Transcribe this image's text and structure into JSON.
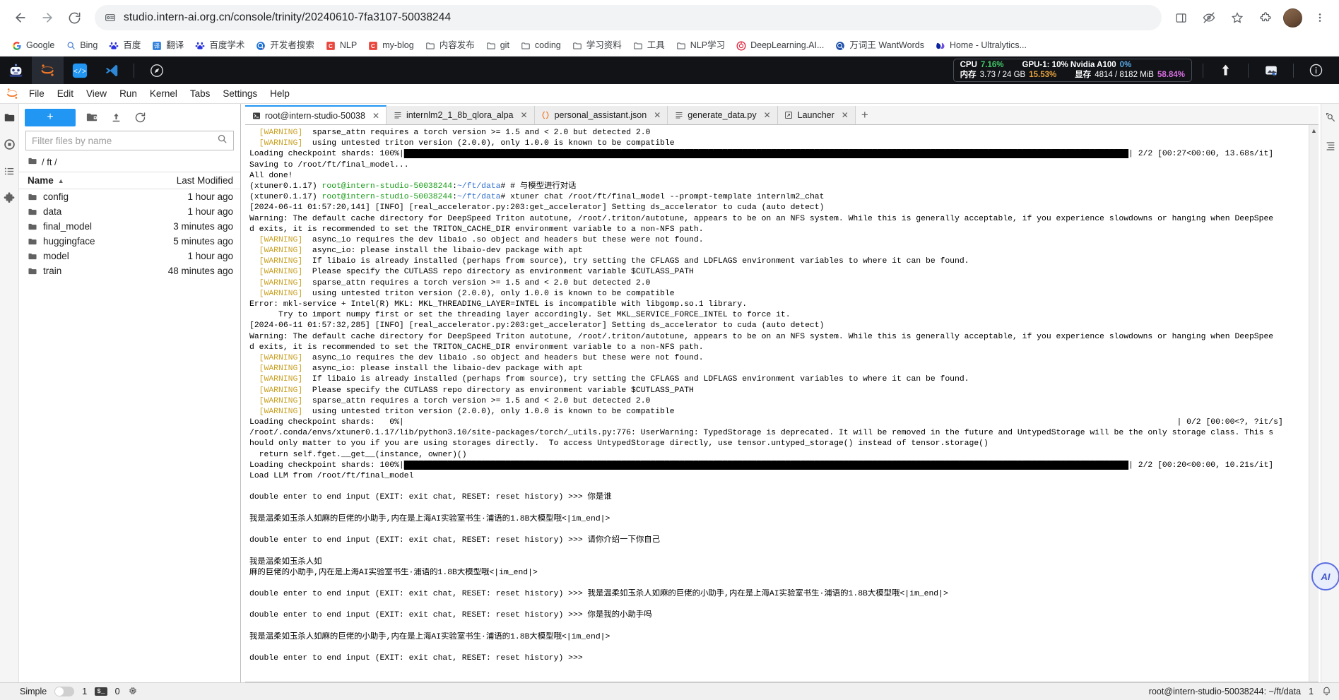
{
  "browser": {
    "url": "studio.intern-ai.org.cn/console/trinity/20240610-7fa3107-50038244",
    "nav": {
      "back": "back-arrow",
      "forward": "forward-arrow",
      "reload": "reload"
    },
    "bookmarks": [
      {
        "label": "Google",
        "icon": "G",
        "icon_kind": "google"
      },
      {
        "label": "Bing",
        "icon": "b",
        "icon_kind": "bing"
      },
      {
        "label": "百度",
        "icon": "B",
        "icon_kind": "baidu"
      },
      {
        "label": "翻译",
        "icon": "译",
        "icon_kind": "fanyi"
      },
      {
        "label": "百度学术",
        "icon": "B",
        "icon_kind": "baidu"
      },
      {
        "label": "开发者搜索",
        "icon": "Q",
        "icon_kind": "devsearch"
      },
      {
        "label": "NLP",
        "icon": "C",
        "icon_kind": "csdn"
      },
      {
        "label": "my-blog",
        "icon": "C",
        "icon_kind": "csdn"
      },
      {
        "label": "内容发布",
        "icon": "",
        "icon_kind": "folder"
      },
      {
        "label": "git",
        "icon": "",
        "icon_kind": "folder"
      },
      {
        "label": "coding",
        "icon": "",
        "icon_kind": "folder"
      },
      {
        "label": "学习资料",
        "icon": "",
        "icon_kind": "folder"
      },
      {
        "label": "工具",
        "icon": "",
        "icon_kind": "folder"
      },
      {
        "label": "NLP学习",
        "icon": "",
        "icon_kind": "folder"
      },
      {
        "label": "DeepLearning.AI...",
        "icon": "",
        "icon_kind": "dlai"
      },
      {
        "label": "万词王 WantWords",
        "icon": "",
        "icon_kind": "wantwords"
      },
      {
        "label": "Home - Ultralytics...",
        "icon": "",
        "icon_kind": "ultralytics"
      }
    ]
  },
  "topbar": {
    "icons": [
      "robot-logo-icon",
      "jupyter-logo-icon",
      "vscode-web-icon",
      "vscode-icon",
      "compass-icon"
    ],
    "right_icons": [
      "upload-icon",
      "image-toggle-icon",
      "info-icon"
    ],
    "sysmon": {
      "cpu_label": "CPU",
      "cpu_value": "7.16%",
      "cpu_color": "#45c96b",
      "mem_label": "内存",
      "mem_value": "3.73 / 24 GB",
      "mem_percent": "15.53%",
      "mem_color": "#e8a33d",
      "gpu_label": "GPU-1: 10% Nvidia A100",
      "gpu_value": "0%",
      "gpu_color": "#5aa9e6",
      "vram_label": "显存",
      "vram_value": "4814 / 8182 MiB",
      "vram_percent": "58.84%",
      "vram_color": "#d96fe0"
    }
  },
  "menubar": {
    "items": [
      "File",
      "Edit",
      "View",
      "Run",
      "Kernel",
      "Tabs",
      "Settings",
      "Help"
    ]
  },
  "rail": {
    "left_icons": [
      "folder-icon",
      "running-terminals-icon",
      "commands-icon",
      "extensions-icon"
    ],
    "right_icons": [
      "property-inspector-icon",
      "toc-icon"
    ]
  },
  "filebrowser": {
    "new_button": "+",
    "toolbar_icons": [
      "new-folder-icon",
      "upload-icon",
      "refresh-icon"
    ],
    "filter_placeholder": "Filter files by name",
    "filter_value": "",
    "breadcrumb": "/ ft /",
    "columns": {
      "name": "Name",
      "modified": "Last Modified"
    },
    "rows": [
      {
        "name": "config",
        "modified": "1 hour ago"
      },
      {
        "name": "data",
        "modified": "1 hour ago"
      },
      {
        "name": "final_model",
        "modified": "3 minutes ago"
      },
      {
        "name": "huggingface",
        "modified": "5 minutes ago"
      },
      {
        "name": "model",
        "modified": "1 hour ago"
      },
      {
        "name": "train",
        "modified": "48 minutes ago"
      }
    ]
  },
  "tabs": [
    {
      "label": "root@intern-studio-50038",
      "icon": "terminal-icon",
      "active": true
    },
    {
      "label": "internlm2_1_8b_qlora_alpa",
      "icon": "text-file-icon",
      "active": false
    },
    {
      "label": "personal_assistant.json",
      "icon": "json-file-icon",
      "active": false
    },
    {
      "label": "generate_data.py",
      "icon": "python-file-icon",
      "active": false
    },
    {
      "label": "Launcher",
      "icon": "launcher-icon",
      "active": false
    }
  ],
  "tab_add_label": "+",
  "terminal": {
    "lines": [
      [
        {
          "t": "  ",
          "c": ""
        },
        {
          "t": "[WARNING]",
          "c": "warn"
        },
        {
          "t": "  sparse_attn requires a torch version >= 1.5 and < 2.0 but detected 2.0",
          "c": ""
        }
      ],
      [
        {
          "t": "  ",
          "c": ""
        },
        {
          "t": "[WARNING]",
          "c": "warn"
        },
        {
          "t": "  using untested triton version (2.0.0), only 1.0.0 is known to be compatible",
          "c": ""
        }
      ],
      [
        {
          "t": "Loading checkpoint shards: 100%|",
          "c": ""
        },
        {
          "t": "██████████████████████████████████████████████████████████████████████████████████████████████████████████████████████████████████████████████████████",
          "c": "bar"
        },
        {
          "t": "| 2/2 [00:27<00:00, 13.68s/it]",
          "c": ""
        }
      ],
      [
        {
          "t": "Saving to /root/ft/final_model...",
          "c": ""
        }
      ],
      [
        {
          "t": "All done!",
          "c": ""
        }
      ],
      [
        {
          "t": "(xtuner0.1.17) ",
          "c": ""
        },
        {
          "t": "root@intern-studio-50038244",
          "c": "green"
        },
        {
          "t": ":",
          "c": ""
        },
        {
          "t": "~/ft/data",
          "c": "blue"
        },
        {
          "t": "# # 与模型进行对话",
          "c": ""
        }
      ],
      [
        {
          "t": "(xtuner0.1.17) ",
          "c": ""
        },
        {
          "t": "root@intern-studio-50038244",
          "c": "green"
        },
        {
          "t": ":",
          "c": ""
        },
        {
          "t": "~/ft/data",
          "c": "blue"
        },
        {
          "t": "# xtuner chat /root/ft/final_model --prompt-template internlm2_chat",
          "c": ""
        }
      ],
      [
        {
          "t": "[2024-06-11 01:57:20,141] [INFO] [real_accelerator.py:203:get_accelerator] Setting ds_accelerator to cuda (auto detect)",
          "c": ""
        }
      ],
      [
        {
          "t": "Warning: The default cache directory for DeepSpeed Triton autotune, /root/.triton/autotune, appears to be on an NFS system. While this is generally acceptable, if you experience slowdowns or hanging when DeepSpee",
          "c": ""
        }
      ],
      [
        {
          "t": "d exits, it is recommended to set the TRITON_CACHE_DIR environment variable to a non-NFS path.",
          "c": ""
        }
      ],
      [
        {
          "t": "  ",
          "c": ""
        },
        {
          "t": "[WARNING]",
          "c": "warn"
        },
        {
          "t": "  async_io requires the dev libaio .so object and headers but these were not found.",
          "c": ""
        }
      ],
      [
        {
          "t": "  ",
          "c": ""
        },
        {
          "t": "[WARNING]",
          "c": "warn"
        },
        {
          "t": "  async_io: please install the libaio-dev package with apt",
          "c": ""
        }
      ],
      [
        {
          "t": "  ",
          "c": ""
        },
        {
          "t": "[WARNING]",
          "c": "warn"
        },
        {
          "t": "  If libaio is already installed (perhaps from source), try setting the CFLAGS and LDFLAGS environment variables to where it can be found.",
          "c": ""
        }
      ],
      [
        {
          "t": "  ",
          "c": ""
        },
        {
          "t": "[WARNING]",
          "c": "warn"
        },
        {
          "t": "  Please specify the CUTLASS repo directory as environment variable $CUTLASS_PATH",
          "c": ""
        }
      ],
      [
        {
          "t": "  ",
          "c": ""
        },
        {
          "t": "[WARNING]",
          "c": "warn"
        },
        {
          "t": "  sparse_attn requires a torch version >= 1.5 and < 2.0 but detected 2.0",
          "c": ""
        }
      ],
      [
        {
          "t": "  ",
          "c": ""
        },
        {
          "t": "[WARNING]",
          "c": "warn"
        },
        {
          "t": "  using untested triton version (2.0.0), only 1.0.0 is known to be compatible",
          "c": ""
        }
      ],
      [
        {
          "t": "Error: mkl-service + Intel(R) MKL: MKL_THREADING_LAYER=INTEL is incompatible with libgomp.so.1 library.",
          "c": ""
        }
      ],
      [
        {
          "t": "      Try to import numpy first or set the threading layer accordingly. Set MKL_SERVICE_FORCE_INTEL to force it.",
          "c": ""
        }
      ],
      [
        {
          "t": "[2024-06-11 01:57:32,285] [INFO] [real_accelerator.py:203:get_accelerator] Setting ds_accelerator to cuda (auto detect)",
          "c": ""
        }
      ],
      [
        {
          "t": "Warning: The default cache directory for DeepSpeed Triton autotune, /root/.triton/autotune, appears to be on an NFS system. While this is generally acceptable, if you experience slowdowns or hanging when DeepSpee",
          "c": ""
        }
      ],
      [
        {
          "t": "d exits, it is recommended to set the TRITON_CACHE_DIR environment variable to a non-NFS path.",
          "c": ""
        }
      ],
      [
        {
          "t": "  ",
          "c": ""
        },
        {
          "t": "[WARNING]",
          "c": "warn"
        },
        {
          "t": "  async_io requires the dev libaio .so object and headers but these were not found.",
          "c": ""
        }
      ],
      [
        {
          "t": "  ",
          "c": ""
        },
        {
          "t": "[WARNING]",
          "c": "warn"
        },
        {
          "t": "  async_io: please install the libaio-dev package with apt",
          "c": ""
        }
      ],
      [
        {
          "t": "  ",
          "c": ""
        },
        {
          "t": "[WARNING]",
          "c": "warn"
        },
        {
          "t": "  If libaio is already installed (perhaps from source), try setting the CFLAGS and LDFLAGS environment variables to where it can be found.",
          "c": ""
        }
      ],
      [
        {
          "t": "  ",
          "c": ""
        },
        {
          "t": "[WARNING]",
          "c": "warn"
        },
        {
          "t": "  Please specify the CUTLASS repo directory as environment variable $CUTLASS_PATH",
          "c": ""
        }
      ],
      [
        {
          "t": "  ",
          "c": ""
        },
        {
          "t": "[WARNING]",
          "c": "warn"
        },
        {
          "t": "  sparse_attn requires a torch version >= 1.5 and < 2.0 but detected 2.0",
          "c": ""
        }
      ],
      [
        {
          "t": "  ",
          "c": ""
        },
        {
          "t": "[WARNING]",
          "c": "warn"
        },
        {
          "t": "  using untested triton version (2.0.0), only 1.0.0 is known to be compatible",
          "c": ""
        }
      ],
      [
        {
          "t": "Loading checkpoint shards:   0%|",
          "c": ""
        },
        {
          "t": "                                                                                                                                                                ",
          "c": ""
        },
        {
          "t": "| 0/2 [00:00<?, ?it/s]",
          "c": ""
        }
      ],
      [
        {
          "t": "/root/.conda/envs/xtuner0.1.17/lib/python3.10/site-packages/torch/_utils.py:776: UserWarning: TypedStorage is deprecated. It will be removed in the future and UntypedStorage will be the only storage class. This s",
          "c": ""
        }
      ],
      [
        {
          "t": "hould only matter to you if you are using storages directly.  To access UntypedStorage directly, use tensor.untyped_storage() instead of tensor.storage()",
          "c": ""
        }
      ],
      [
        {
          "t": "  return self.fget.__get__(instance, owner)()",
          "c": ""
        }
      ],
      [
        {
          "t": "Loading checkpoint shards: 100%|",
          "c": ""
        },
        {
          "t": "██████████████████████████████████████████████████████████████████████████████████████████████████████████████████████████████████████████████████████",
          "c": "bar"
        },
        {
          "t": "| 2/2 [00:20<00:00, 10.21s/it]",
          "c": ""
        }
      ],
      [
        {
          "t": "Load LLM from /root/ft/final_model",
          "c": ""
        }
      ],
      [
        {
          "t": "",
          "c": ""
        }
      ],
      [
        {
          "t": "double enter to end input (EXIT: exit chat, RESET: reset history) >>> 你是谁",
          "c": ""
        }
      ],
      [
        {
          "t": "",
          "c": ""
        }
      ],
      [
        {
          "t": "我是温柔如玉杀人如麻的巨佬的小助手,内在是上海AI实验室书生·浦语的1.8B大模型哦<|im_end|>",
          "c": ""
        }
      ],
      [
        {
          "t": "",
          "c": ""
        }
      ],
      [
        {
          "t": "double enter to end input (EXIT: exit chat, RESET: reset history) >>> 请你介绍一下你自己",
          "c": ""
        }
      ],
      [
        {
          "t": "",
          "c": ""
        }
      ],
      [
        {
          "t": "我是温柔如玉杀人如",
          "c": ""
        }
      ],
      [
        {
          "t": "麻的巨佬的小助手,内在是上海AI实验室书生·浦语的1.8B大模型哦<|im_end|>",
          "c": ""
        }
      ],
      [
        {
          "t": "",
          "c": ""
        }
      ],
      [
        {
          "t": "double enter to end input (EXIT: exit chat, RESET: reset history) >>> 我是温柔如玉杀人如麻的巨佬的小助手,内在是上海AI实验室书生·浦语的1.8B大模型哦<|im_end|>",
          "c": ""
        }
      ],
      [
        {
          "t": "",
          "c": ""
        }
      ],
      [
        {
          "t": "double enter to end input (EXIT: exit chat, RESET: reset history) >>> 你是我的小助手吗",
          "c": ""
        }
      ],
      [
        {
          "t": "",
          "c": ""
        }
      ],
      [
        {
          "t": "我是温柔如玉杀人如麻的巨佬的小助手,内在是上海AI实验室书生·浦语的1.8B大模型哦<|im_end|>",
          "c": ""
        }
      ],
      [
        {
          "t": "",
          "c": ""
        }
      ],
      [
        {
          "t": "double enter to end input (EXIT: exit chat, RESET: reset history) >>> ",
          "c": ""
        }
      ]
    ]
  },
  "ai_bubble": {
    "label": "AI"
  },
  "statusbar": {
    "simple_label": "Simple",
    "simple_on": false,
    "kernel_count": "1",
    "terminal_icon": "terminal-icon",
    "terminal_count": "0",
    "cpu_icon": "cpu-icon",
    "session": "root@intern-studio-50038244: ~/ft/data",
    "notif_count": "1",
    "bell_icon": "bell-icon"
  }
}
